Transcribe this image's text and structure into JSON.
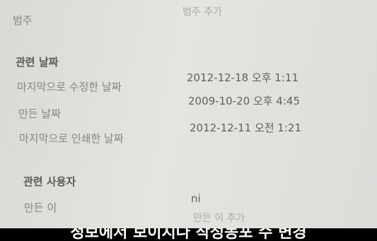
{
  "category": {
    "label": "범주",
    "add_placeholder": "범주 추가"
  },
  "related_dates": {
    "heading": "관련 날짜",
    "rows": [
      {
        "label": "마지막으로 수정한 날짜",
        "value": "2012-12-18 오후 1:11"
      },
      {
        "label": "만든 날짜",
        "value": "2009-10-20 오후 4:45"
      },
      {
        "label": "마지막으로 인쇄한 날짜",
        "value": "2012-12-11 오전 1:21"
      }
    ]
  },
  "related_people": {
    "heading": "관련 사용자",
    "author_label": "만든 이",
    "author_value": "ni",
    "add_author": "만든 이 추가"
  },
  "subtitle": "정보에서 보이지나 작성동포 수 변경"
}
